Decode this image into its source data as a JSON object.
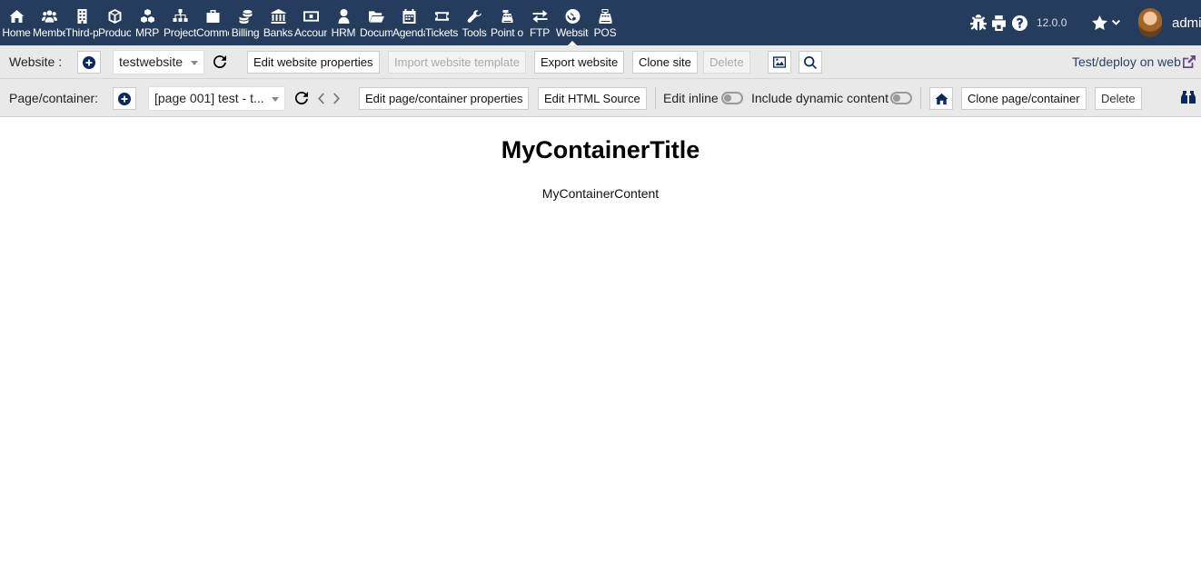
{
  "topnav": {
    "menu": [
      {
        "label": "Home",
        "icon": "home-icon"
      },
      {
        "label": "Members",
        "icon": "members-icon"
      },
      {
        "label": "Third-parties",
        "icon": "building-icon"
      },
      {
        "label": "Products",
        "icon": "cube-icon"
      },
      {
        "label": "MRP",
        "icon": "cubes-icon"
      },
      {
        "label": "Projects",
        "icon": "sitemap-icon"
      },
      {
        "label": "Commercial",
        "icon": "briefcase-icon"
      },
      {
        "label": "Billing",
        "icon": "coins-icon"
      },
      {
        "label": "Banks",
        "icon": "bank-icon"
      },
      {
        "label": "Accounting",
        "icon": "money-bill-icon"
      },
      {
        "label": "HRM",
        "icon": "user-tie-icon"
      },
      {
        "label": "Documents",
        "icon": "folder-open-icon"
      },
      {
        "label": "Agenda",
        "icon": "calendar-icon"
      },
      {
        "label": "Tickets",
        "icon": "ticket-icon"
      },
      {
        "label": "Tools",
        "icon": "wrench-icon"
      },
      {
        "label": "Point of sale",
        "icon": "cash-register-icon"
      },
      {
        "label": "FTP",
        "icon": "exchange-icon"
      },
      {
        "label": "Websites",
        "icon": "globe-icon"
      },
      {
        "label": "POS",
        "icon": "pos-icon"
      }
    ],
    "active_menu": "Websites",
    "version": "12.0.0",
    "username": "admin"
  },
  "website_bar": {
    "label": "Website :",
    "site_select": "testwebsite",
    "edit_properties": "Edit website properties",
    "import_template": "Import website template",
    "export": "Export website",
    "clone": "Clone site",
    "delete": "Delete",
    "deploy_link": "Test/deploy on web"
  },
  "page_bar": {
    "label": "Page/container:",
    "page_select": "[page 001] test - t...",
    "edit_properties": "Edit page/container properties",
    "edit_html": "Edit HTML Source",
    "edit_inline": "Edit inline",
    "edit_inline_on": false,
    "dynamic_content": "Include dynamic content",
    "dynamic_content_on": false,
    "clone": "Clone page/container",
    "delete": "Delete"
  },
  "content": {
    "title": "MyContainerTitle",
    "body": "MyContainerContent"
  },
  "colors": {
    "topbar": "#263c5c",
    "toolbar": "#e9e9e9",
    "icon_blue": "#0b2a5a"
  }
}
